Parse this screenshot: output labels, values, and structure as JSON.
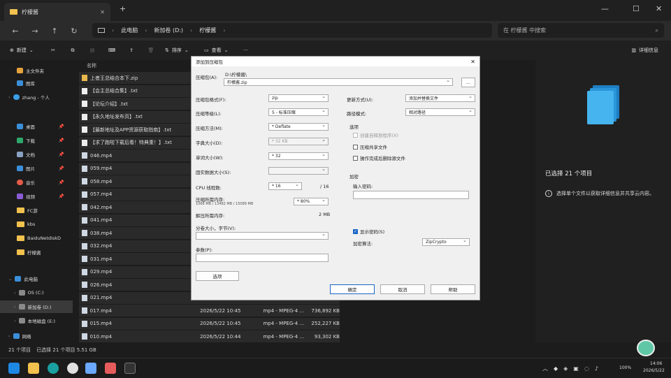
{
  "window": {
    "tab_title": "柠檬酱",
    "add_tab": "+",
    "min": "—",
    "max": "☐",
    "close": "✕"
  },
  "nav": {
    "back": "←",
    "fwd": "→",
    "up": "↑",
    "refresh": "↻",
    "breadcrumb": [
      "此电脑",
      "新加卷 (D:)",
      "柠檬酱"
    ],
    "search_placeholder": "在 柠檬酱 中搜索"
  },
  "toolbar": {
    "new": "新建",
    "sort": "排序",
    "view": "查看",
    "more": "···",
    "details": "详细信息"
  },
  "sidebar": {
    "items": [
      "主文件夹",
      "图库",
      "zhang - 个人",
      "桌面",
      "下载",
      "文档",
      "图片",
      "音乐",
      "视频",
      "FC游",
      "kbs",
      "BaiduNetdiskD",
      "柠檬酱"
    ],
    "this_pc": "此电脑",
    "drives": [
      "OS (C:)",
      "新加卷 (D:)",
      "本地磁盘 (E:)"
    ],
    "network": "网络"
  },
  "list": {
    "col_name": "名称",
    "files": [
      "上者王总结合本下.zip",
      "【会主总结合集】.txt",
      "【论坛介绍】.txt",
      "【永久地址发布页】.txt",
      "【最新地址及APP资源获取指南】.txt",
      "【求了跑啦下载后看！特典重！】.txt",
      "046.mp4",
      "059.mp4",
      "058.mp4",
      "057.mp4",
      "042.mp4",
      "041.mp4",
      "038.mp4",
      "032.mp4",
      "031.mp4",
      "029.mp4",
      "026.mp4",
      "021.mp4",
      "017.mp4",
      "015.mp4",
      "010.mp4"
    ],
    "dates": [
      "2026/5/22 10:45",
      "2026/5/22 10:45",
      "2026/5/22 10:44"
    ],
    "types": [
      "mp4 - MPEG-4 ...",
      "mp4 - MPEG-4 ...",
      "mp4 - MPEG-4 ..."
    ],
    "sizes": [
      "736,892 KB",
      "252,227 KB",
      "93,302 KB"
    ]
  },
  "status": {
    "count": "21 个项目",
    "selected": "已选择 21 个项目 5.51 GB"
  },
  "right": {
    "selected": "已选择 21 个项目",
    "hint": "选择单个文件以获取详细信息并共享云内容。"
  },
  "dialog": {
    "title": "添加到压缩包",
    "archive_label": "压缩包(A):",
    "archive_dir": "D:\\柠檬酱\\",
    "archive_name": "柠檬酱.zip",
    "browse": "...",
    "format_label": "压缩包格式(F):",
    "format": "zip",
    "level_label": "压缩等级(L):",
    "level": "5 - 标准压缩",
    "method_label": "压缩方法(M):",
    "method": "* Deflate",
    "dict_label": "字典大小(D):",
    "dict": "* 32 KB",
    "word_label": "单词大小(W):",
    "word": "* 32",
    "block_label": "固实数据大小(S):",
    "threads_label": "CPU 线程数:",
    "threads": "* 16",
    "threads_max": "/ 16",
    "mem_label": "压缩所需内存:",
    "mem_sub": "1068 MB / 13482 MB / 15089 MB",
    "mem_val": "* 80%",
    "decmem_label": "解压所需内存:",
    "decmem_val": "2 MB",
    "split_label": "分卷大小，字节(V):",
    "params_label": "参数(P):",
    "options_btn": "选项",
    "update_label": "更新方式(U):",
    "update": "添加并替换文件",
    "path_label": "路径模式:",
    "path": "相对路径",
    "opts_label": "选项",
    "opt1": "创建自释放程序(X)",
    "opt2": "压缩共享文件",
    "opt3": "操作完成后删除源文件",
    "enc_label": "加密",
    "pw_label": "输入密码:",
    "show_pw": "显示密码(S)",
    "enc_method_label": "加密算法:",
    "enc_method": "ZipCrypto",
    "ok": "确定",
    "cancel": "取消",
    "help": "帮助"
  },
  "taskbar": {
    "time": "14:06",
    "date": "2026/5/22",
    "battery": "100%"
  }
}
